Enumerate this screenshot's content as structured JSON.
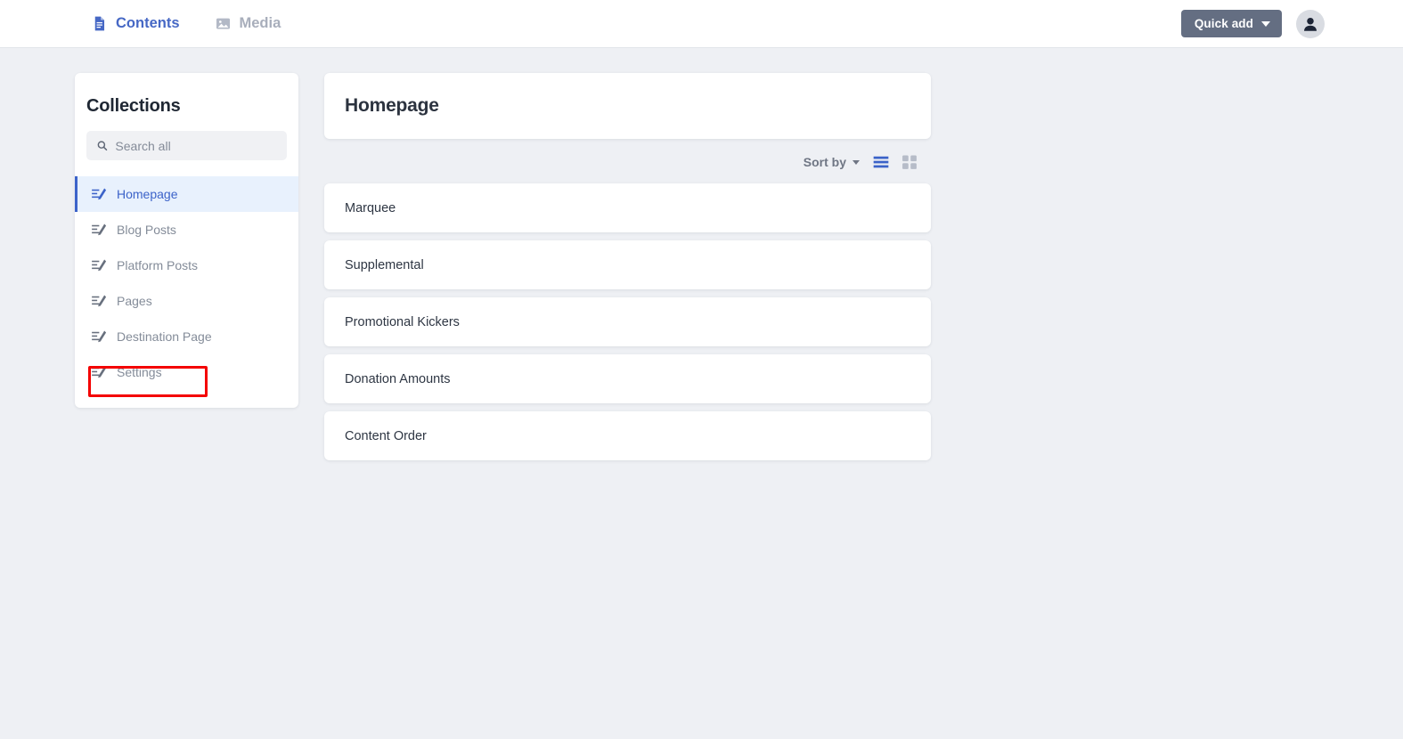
{
  "topbar": {
    "nav_items": [
      {
        "label": "Contents",
        "icon": "document-icon",
        "active": true
      },
      {
        "label": "Media",
        "icon": "image-icon",
        "active": false
      }
    ],
    "quick_add_label": "Quick add",
    "quick_add_icon": "chevron-down-icon",
    "avatar_icon": "user-avatar-icon",
    "accent_color": "#4668c5",
    "quick_add_bg": "#646e82"
  },
  "sidebar": {
    "title": "Collections",
    "search": {
      "placeholder": "Search all",
      "value": "",
      "icon": "search-icon"
    },
    "items": [
      {
        "label": "Homepage",
        "icon": "post-edit-icon",
        "selected": true
      },
      {
        "label": "Blog Posts",
        "icon": "post-edit-icon",
        "selected": false
      },
      {
        "label": "Platform Posts",
        "icon": "post-edit-icon",
        "selected": false
      },
      {
        "label": "Pages",
        "icon": "post-edit-icon",
        "selected": false
      },
      {
        "label": "Destination Page",
        "icon": "post-edit-icon",
        "selected": false
      },
      {
        "label": "Settings",
        "icon": "post-edit-icon",
        "selected": false
      }
    ],
    "highlight": {
      "target_label": "Settings",
      "color": "#f40000"
    }
  },
  "main": {
    "page_title": "Homepage",
    "toolbar": {
      "sort_by_label": "Sort by",
      "sort_by_icon": "chevron-down-icon",
      "list_view_icon": "list-view-icon",
      "grid_view_icon": "grid-view-icon",
      "active_view": "list"
    },
    "cards": [
      {
        "label": "Marquee"
      },
      {
        "label": "Supplemental"
      },
      {
        "label": "Promotional Kickers"
      },
      {
        "label": "Donation Amounts"
      },
      {
        "label": "Content Order"
      }
    ]
  }
}
